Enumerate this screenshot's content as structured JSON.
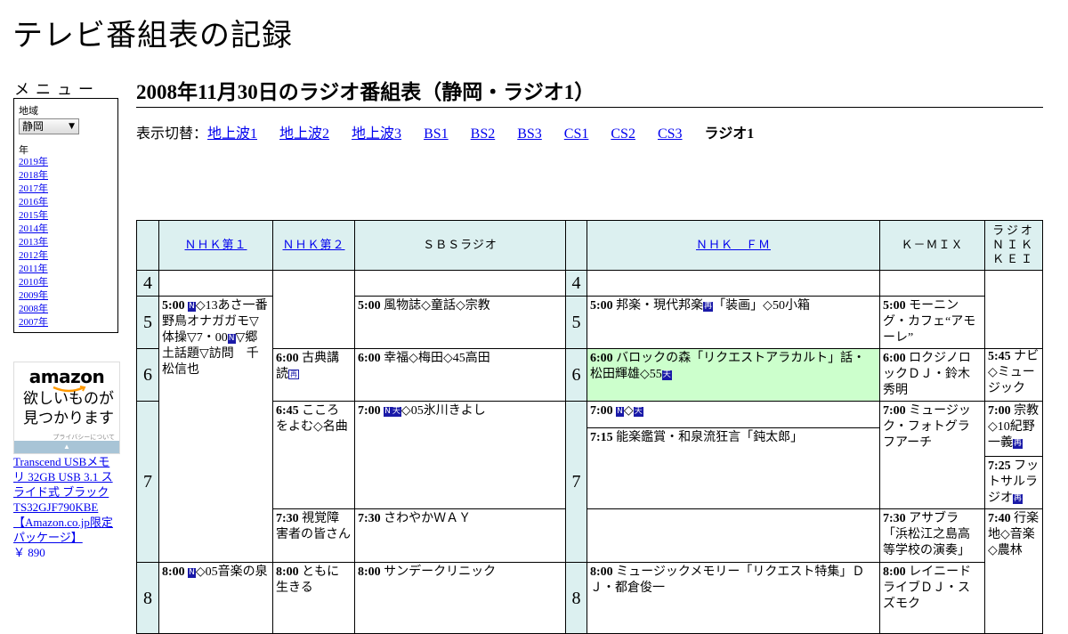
{
  "site_title": "テレビ番組表の記録",
  "menu": {
    "heading": "メニュー",
    "region_label": "地域",
    "region_value": "静岡",
    "year_label": "年",
    "years": [
      "2019年",
      "2018年",
      "2017年",
      "2016年",
      "2015年",
      "2014年",
      "2013年",
      "2012年",
      "2011年",
      "2010年",
      "2009年",
      "2008年",
      "2007年"
    ]
  },
  "ad": {
    "logo": "amazon",
    "tagline_1": "欲しいものが",
    "tagline_2": "見つかります",
    "privacy": "プライバシーについて",
    "product": "Transcend USBメモリ 32GB USB 3.1 スライド式 ブラック TS32GJF790KBE 【Amazon.co.jp限定パッケージ】",
    "price": "￥ 890"
  },
  "heading": "2008年11月30日のラジオ番組表（静岡・ラジオ1）",
  "switcher": {
    "label": "表示切替：",
    "links": [
      "地上波1",
      "地上波2",
      "地上波3",
      "BS1",
      "BS2",
      "BS3",
      "CS1",
      "CS2",
      "CS3"
    ],
    "current": "ラジオ1"
  },
  "channels": [
    "ＮＨＫ第１",
    "ＮＨＫ第２",
    "ＳＢＳラジオ",
    "ＮＨＫ　ＦＭ",
    "Ｋ－ＭＩＸ",
    "ラジオＮＩＫＫＥＩ"
  ],
  "hours": [
    "4",
    "5",
    "6",
    "7",
    "8"
  ],
  "programs": {
    "nhk1_500": {
      "time": "5:00",
      "b1": "N",
      "title": "◇13あさ一番　野鳥オナガガモ▽体操▽7・00",
      "b2": "N",
      "rest": "▽郷土話題▽訪問　千松信也"
    },
    "nhk1_800": {
      "time": "8:00",
      "b1": "N",
      "title": "◇05音楽の泉"
    },
    "nhk2_600": {
      "time": "6:00",
      "title": "古典講読",
      "b1": "再"
    },
    "nhk2_645": {
      "time": "6:45",
      "title": "こころをよむ◇名曲"
    },
    "nhk2_730": {
      "time": "7:30",
      "title": "視覚障害者の皆さん"
    },
    "nhk2_800": {
      "time": "8:00",
      "title": "ともに生きる"
    },
    "sbs_500": {
      "time": "5:00",
      "title": "風物誌◇童話◇宗教"
    },
    "sbs_600": {
      "time": "6:00",
      "title": "幸福◇梅田◇45高田"
    },
    "sbs_700": {
      "time": "7:00",
      "b1": "N",
      "b2": "天",
      "title": "◇05氷川きよし"
    },
    "sbs_730": {
      "time": "7:30",
      "title": "さわやかＷＡＹ"
    },
    "sbs_800": {
      "time": "8:00",
      "title": "サンデークリニック"
    },
    "fm_500": {
      "time": "5:00",
      "title": "邦楽・現代邦楽",
      "b1": "再",
      "rest": "「装画」◇50小箱"
    },
    "fm_600": {
      "time": "6:00",
      "title": "バロックの森「リクエストアラカルト」話・松田輝雄◇55",
      "b1": "天"
    },
    "fm_700": {
      "time": "7:00",
      "b1": "N",
      "title": "◇",
      "b2": "天"
    },
    "fm_715": {
      "time": "7:15",
      "title": "能楽鑑賞・和泉流狂言「鈍太郎」"
    },
    "fm_800": {
      "time": "8:00",
      "title": "ミュージックメモリー「リクエスト特集」ＤＪ・都倉俊一"
    },
    "kmix_500": {
      "time": "5:00",
      "title": "モーニング・カフェ“アモーレ”"
    },
    "kmix_600": {
      "time": "6:00",
      "title": "ロクジノロックＤＪ・鈴木秀明"
    },
    "kmix_700": {
      "time": "7:00",
      "title": "ミュージック・フォトグラフアーチ"
    },
    "kmix_730": {
      "time": "7:30",
      "title": "アサブラ「浜松江之島高等学校の演奏」"
    },
    "kmix_800": {
      "time": "8:00",
      "title": "レイニードライブＤＪ・スズモク"
    },
    "nikkei_545": {
      "time": "5:45",
      "title": "ナビ◇ミュージック"
    },
    "nikkei_700": {
      "time": "7:00",
      "title": "宗教◇10紀野一義",
      "b1": "再"
    },
    "nikkei_725": {
      "time": "7:25",
      "title": "フットサルラジオ",
      "b1": "再"
    },
    "nikkei_740": {
      "time": "7:40",
      "title": "行楽地◇音楽◇農林"
    }
  },
  "colors": {
    "header_bg": "#dcf0f0",
    "highlight_bg": "#ccffcc",
    "badge": "#1a1aa8",
    "link": "#0000ee"
  }
}
